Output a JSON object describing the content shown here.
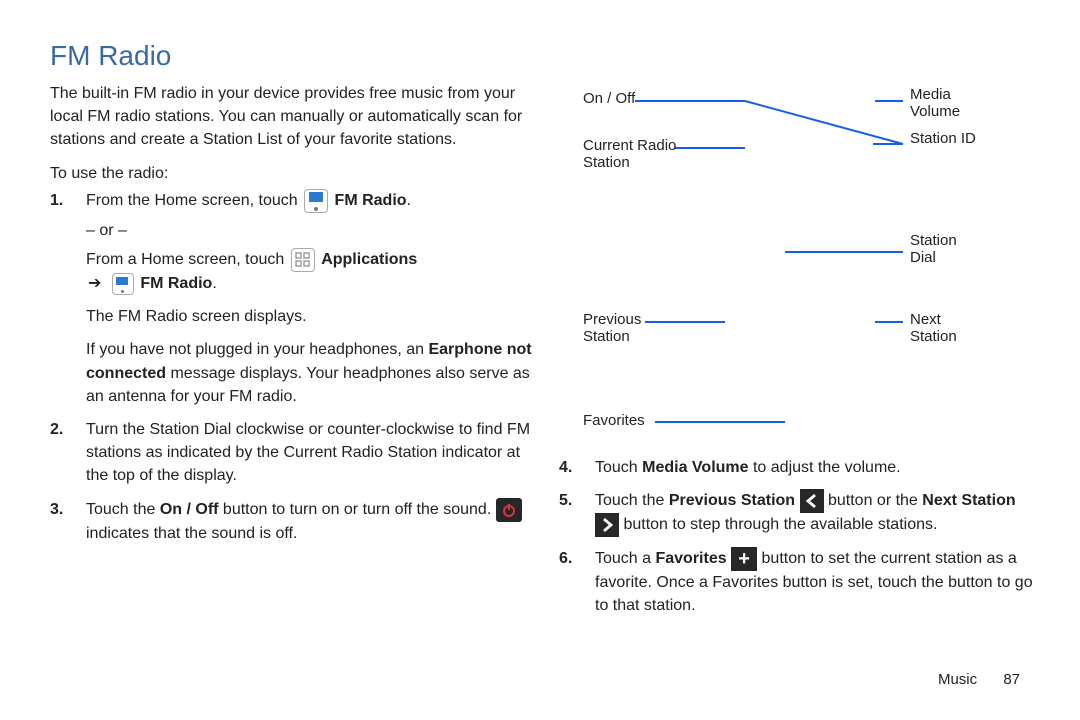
{
  "heading": "FM Radio",
  "intro": "The built-in FM radio in your device provides free music from your local FM radio stations. You can manually or automatically scan for stations and create a Station List of your favorite stations.",
  "to_use": "To use the radio:",
  "steps_left": {
    "s1": {
      "num": "1.",
      "a": "From the Home screen, touch ",
      "a_bold": "FM Radio",
      "a_end": ".",
      "or": "– or –",
      "b": "From a Home screen, touch ",
      "b_bold": "Applications",
      "c_arrow": "➔",
      "c_bold": "FM Radio",
      "c_end": ".",
      "d": "The FM Radio screen displays.",
      "e_a": "If you have not plugged in your headphones, an ",
      "e_bold": "Earphone not connected",
      "e_b": " message displays. Your headphones also serve as an antenna for your FM radio."
    },
    "s2": {
      "num": "2.",
      "t": "Turn the Station Dial clockwise or counter-clockwise to find FM stations as indicated by the Current Radio Station indicator at the top of the display."
    },
    "s3": {
      "num": "3.",
      "a": "Touch the ",
      "a_bold": "On / Off",
      "b": " button to turn on or turn off the sound. ",
      "c": " indicates that the sound is off."
    }
  },
  "diagram_labels": {
    "onoff": "On / Off",
    "media_volume": "Media Volume",
    "current": "Current Radio Station",
    "station_id": "Station ID",
    "station_dial": "Station Dial",
    "previous": "Previous Station",
    "next": "Next Station",
    "favorites": "Favorites"
  },
  "steps_right": {
    "s4": {
      "num": "4.",
      "a": "Touch ",
      "a_bold": "Media Volume",
      "b": " to adjust the volume."
    },
    "s5": {
      "num": "5.",
      "a": "Touch the ",
      "a_bold": "Previous Station",
      "mid": " button or the ",
      "b_bold": "Next Station",
      "c": " button to step through the available stations."
    },
    "s6": {
      "num": "6.",
      "a": "Touch a ",
      "a_bold": "Favorites",
      "b": " button to set the current station as a favorite. Once a Favorites button is set, touch the button to go to that station."
    }
  },
  "footer": {
    "section": "Music",
    "page": "87"
  }
}
